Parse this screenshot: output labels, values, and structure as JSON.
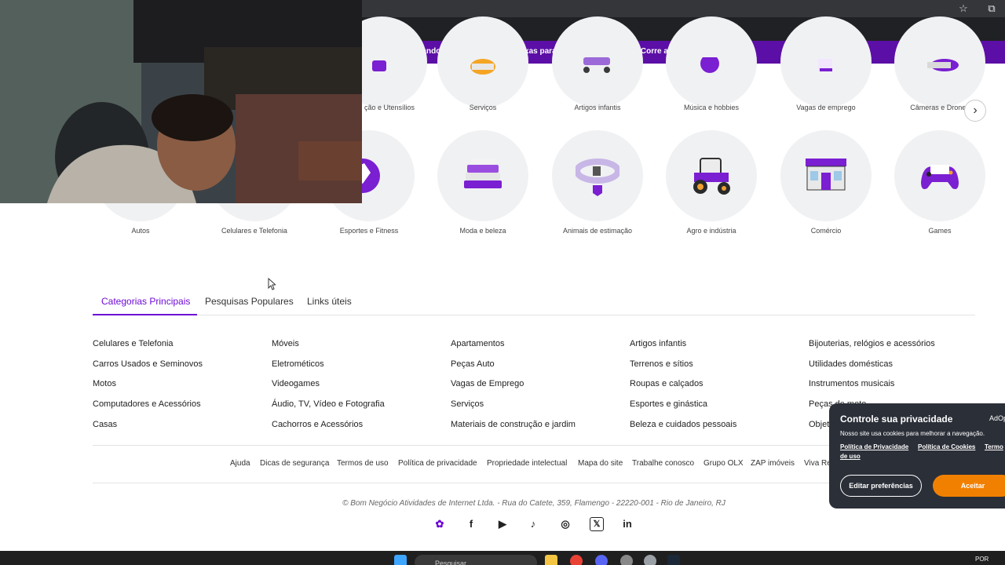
{
  "promo_banner": {
    "text": "Buscando um carro com boas taxas para financiar em até 60x? Corre aqui!"
  },
  "categories_row1": [
    {
      "label": "ção e Utensílios"
    },
    {
      "label": "Serviços"
    },
    {
      "label": "Artigos infantis"
    },
    {
      "label": "Música e hobbies"
    },
    {
      "label": "Vagas de emprego"
    },
    {
      "label": "Câmeras e Drones"
    }
  ],
  "categories_row2": [
    {
      "label": "Autos"
    },
    {
      "label": "Celulares e Telefonia"
    },
    {
      "label": "Esportes e Fitness"
    },
    {
      "label": "Moda e beleza"
    },
    {
      "label": "Animais de estimação"
    },
    {
      "label": "Agro e indústria"
    },
    {
      "label": "Comércio"
    },
    {
      "label": "Games"
    }
  ],
  "tabs": [
    {
      "label": "Categorias Principais",
      "active": true
    },
    {
      "label": "Pesquisas Populares",
      "active": false
    },
    {
      "label": "Links úteis",
      "active": false
    }
  ],
  "link_columns": [
    [
      "Celulares e Telefonia",
      "Carros Usados e Seminovos",
      "Motos",
      "Computadores e Acessórios",
      "Casas"
    ],
    [
      "Móveis",
      "Eletrométicos",
      "Videogames",
      "Áudio, TV, Vídeo e Fotografia",
      "Cachorros e Acessórios"
    ],
    [
      "Apartamentos",
      "Peças Auto",
      "Vagas de Emprego",
      "Serviços",
      "Materiais de construção e jardim"
    ],
    [
      "Artigos infantis",
      "Terrenos e sítios",
      "Roupas e calçados",
      "Esportes e ginástica",
      "Beleza e cuidados pessoais"
    ],
    [
      "Bijouterias, relógios e acessórios",
      "Utilidades domésticas",
      "Instrumentos musicais",
      "Peças de moto",
      "Objet"
    ]
  ],
  "footer_links": [
    "Ajuda",
    "Dicas de segurança",
    "Termos de uso",
    "Política de privacidade",
    "Propriedade intelectual",
    "Mapa do site",
    "Trabalhe conosco",
    "Grupo OLX",
    "ZAP imóveis",
    "Viva Re"
  ],
  "copyright": "© Bom Negócio Atividades de Internet Ltda. - Rua do Catete, 359, Flamengo - 22220-001 - Rio de Janeiro, RJ",
  "social_icons": [
    "olx-icon",
    "facebook-icon",
    "youtube-icon",
    "tiktok-icon",
    "instagram-icon",
    "x-icon",
    "linkedin-icon"
  ],
  "cookie_banner": {
    "title": "Controle sua privacidade",
    "brand": "AdOp",
    "description": "Nosso site usa cookies para melhorar a navegação.",
    "privacy_link": "Política de Privacidade",
    "cookies_link": "Política de Cookies",
    "terms_link_part1": "Termo",
    "terms_link_part2": "de uso",
    "edit_button": "Editar preferências",
    "accept_button": "Aceitar"
  },
  "taskbar": {
    "search_placeholder": "Pesquisar",
    "language": "POR"
  },
  "colors": {
    "brand_purple": "#6e0ad6",
    "banner_purple": "#5c0fa6",
    "accept_orange": "#f28000",
    "circle_bg": "#f0f1f3"
  }
}
